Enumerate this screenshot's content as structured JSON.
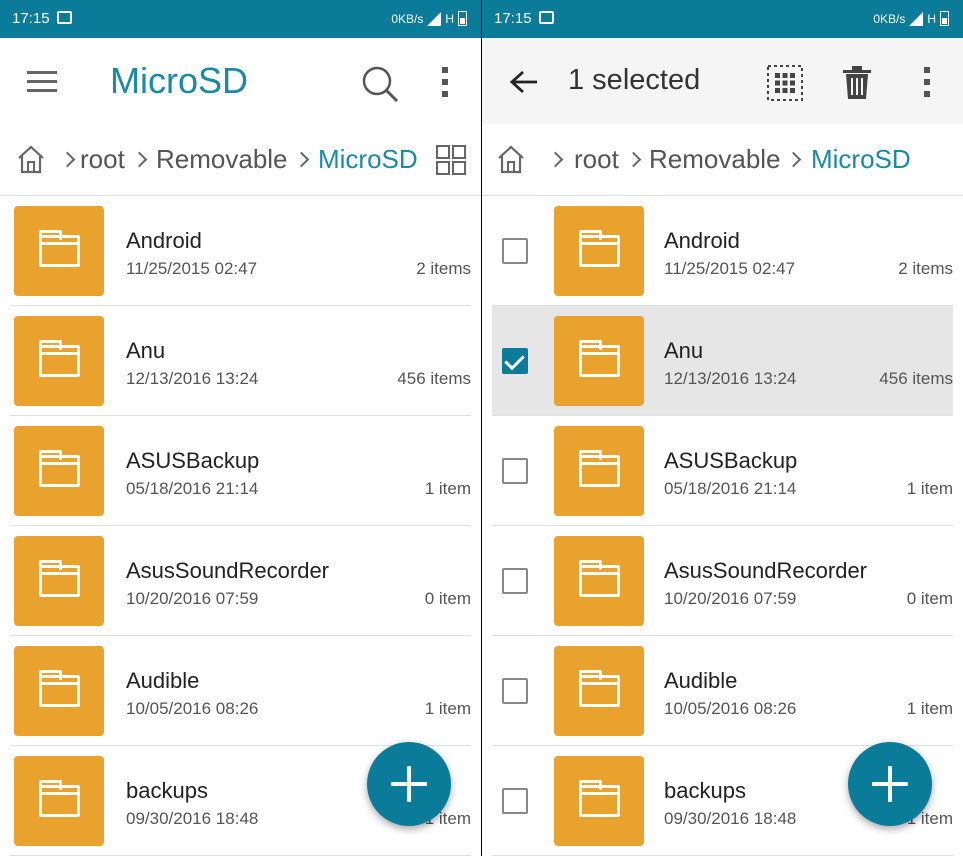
{
  "status": {
    "time": "17:15",
    "speed": "0KB/s",
    "network": "H"
  },
  "left": {
    "title": "MicroSD",
    "breadcrumb": [
      "root",
      "Removable",
      "MicroSD"
    ]
  },
  "right": {
    "selection_label": "1 selected",
    "breadcrumb": [
      "root",
      "Removable",
      "MicroSD"
    ]
  },
  "folders": [
    {
      "name": "Android",
      "date": "11/25/2015 02:47",
      "count": "2 items",
      "checked": false
    },
    {
      "name": "Anu",
      "date": "12/13/2016 13:24",
      "count": "456 items",
      "checked": true
    },
    {
      "name": "ASUSBackup",
      "date": "05/18/2016 21:14",
      "count": "1 item",
      "checked": false
    },
    {
      "name": "AsusSoundRecorder",
      "date": "10/20/2016 07:59",
      "count": "0 item",
      "checked": false
    },
    {
      "name": "Audible",
      "date": "10/05/2016 08:26",
      "count": "1 item",
      "checked": false
    },
    {
      "name": "backups",
      "date": "09/30/2016 18:48",
      "count": "1 item",
      "checked": false
    }
  ],
  "colors": {
    "accent": "#0a7b99",
    "folder": "#e8a22d",
    "title": "#1b8aa5"
  },
  "icons": [
    "menu-icon",
    "search-icon",
    "more-vert-icon",
    "home-icon",
    "grid-view-icon",
    "back-arrow-icon",
    "select-all-icon",
    "delete-icon",
    "add-icon",
    "folder-icon"
  ]
}
